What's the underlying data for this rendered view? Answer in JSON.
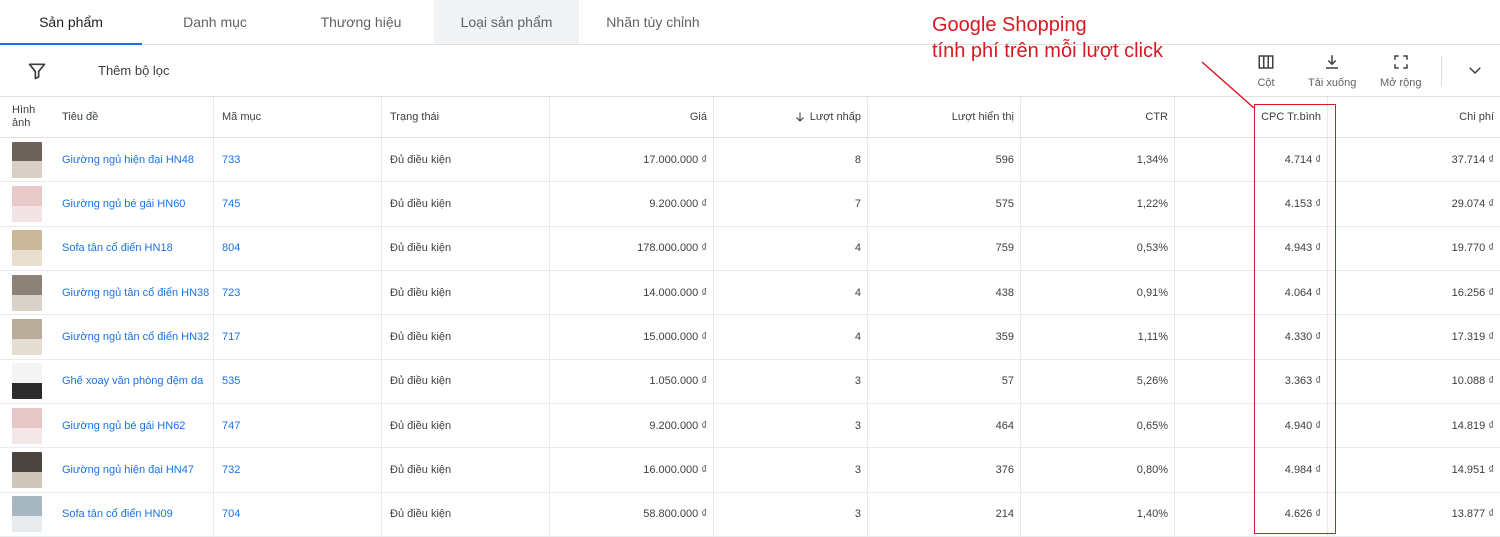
{
  "tabs": [
    {
      "label": "Sản phẩm",
      "active": true
    },
    {
      "label": "Danh mục",
      "active": false
    },
    {
      "label": "Thương hiệu",
      "active": false
    },
    {
      "label": "Loại sản phẩm",
      "active": false
    },
    {
      "label": "Nhãn tùy chỉnh",
      "active": false
    }
  ],
  "filter": {
    "add_filter_label": "Thêm bộ lọc"
  },
  "toolbar": {
    "columns_label": "Cột",
    "download_label": "Tải xuống",
    "expand_label": "Mở rộng"
  },
  "table": {
    "headers": {
      "image": "Hình ảnh",
      "title": "Tiêu đề",
      "id": "Mã mục",
      "status": "Trạng thái",
      "price": "Giá",
      "clicks": "Lượt nhấp",
      "impressions": "Lượt hiển thị",
      "ctr": "CTR",
      "cpc": "CPC Tr.bình",
      "cost": "Chi phí"
    },
    "sorted_column": "clicks",
    "rows": [
      {
        "title": "Giường ngủ hiện đại HN48",
        "id": "733",
        "status": "Đủ điều kiện",
        "price": "17.000.000 ₫",
        "clicks": "8",
        "impressions": "596",
        "ctr": "1,34%",
        "cpc": "4.714 ₫",
        "cost": "37.714 ₫"
      },
      {
        "title": "Giường ngủ bé gái HN60",
        "id": "745",
        "status": "Đủ điều kiện",
        "price": "9.200.000 ₫",
        "clicks": "7",
        "impressions": "575",
        "ctr": "1,22%",
        "cpc": "4.153 ₫",
        "cost": "29.074 ₫"
      },
      {
        "title": "Sofa tân cổ điển HN18",
        "id": "804",
        "status": "Đủ điều kiện",
        "price": "178.000.000 ₫",
        "clicks": "4",
        "impressions": "759",
        "ctr": "0,53%",
        "cpc": "4.943 ₫",
        "cost": "19.770 ₫"
      },
      {
        "title": "Giường ngủ tân cổ điển HN38",
        "id": "723",
        "status": "Đủ điều kiện",
        "price": "14.000.000 ₫",
        "clicks": "4",
        "impressions": "438",
        "ctr": "0,91%",
        "cpc": "4.064 ₫",
        "cost": "16.256 ₫"
      },
      {
        "title": "Giường ngủ tân cổ điển HN32",
        "id": "717",
        "status": "Đủ điều kiện",
        "price": "15.000.000 ₫",
        "clicks": "4",
        "impressions": "359",
        "ctr": "1,11%",
        "cpc": "4.330 ₫",
        "cost": "17.319 ₫"
      },
      {
        "title": "Ghế xoay văn phòng đệm da",
        "id": "535",
        "status": "Đủ điều kiện",
        "price": "1.050.000 ₫",
        "clicks": "3",
        "impressions": "57",
        "ctr": "5,26%",
        "cpc": "3.363 ₫",
        "cost": "10.088 ₫"
      },
      {
        "title": "Giường ngủ bé gái HN62",
        "id": "747",
        "status": "Đủ điều kiện",
        "price": "9.200.000 ₫",
        "clicks": "3",
        "impressions": "464",
        "ctr": "0,65%",
        "cpc": "4.940 ₫",
        "cost": "14.819 ₫"
      },
      {
        "title": "Giường ngủ hiện đại HN47",
        "id": "732",
        "status": "Đủ điều kiện",
        "price": "16.000.000 ₫",
        "clicks": "3",
        "impressions": "376",
        "ctr": "0,80%",
        "cpc": "4.984 ₫",
        "cost": "14.951 ₫"
      },
      {
        "title": "Sofa tân cổ điển HN09",
        "id": "704",
        "status": "Đủ điều kiện",
        "price": "58.800.000 ₫",
        "clicks": "3",
        "impressions": "214",
        "ctr": "1,40%",
        "cpc": "4.626 ₫",
        "cost": "13.877 ₫"
      }
    ]
  },
  "annotation": {
    "line1": "Google Shopping",
    "line2": "tính phí trên mỗi lượt click"
  },
  "colors": {
    "accent": "#1a73e8",
    "annotation": "#d71920"
  }
}
